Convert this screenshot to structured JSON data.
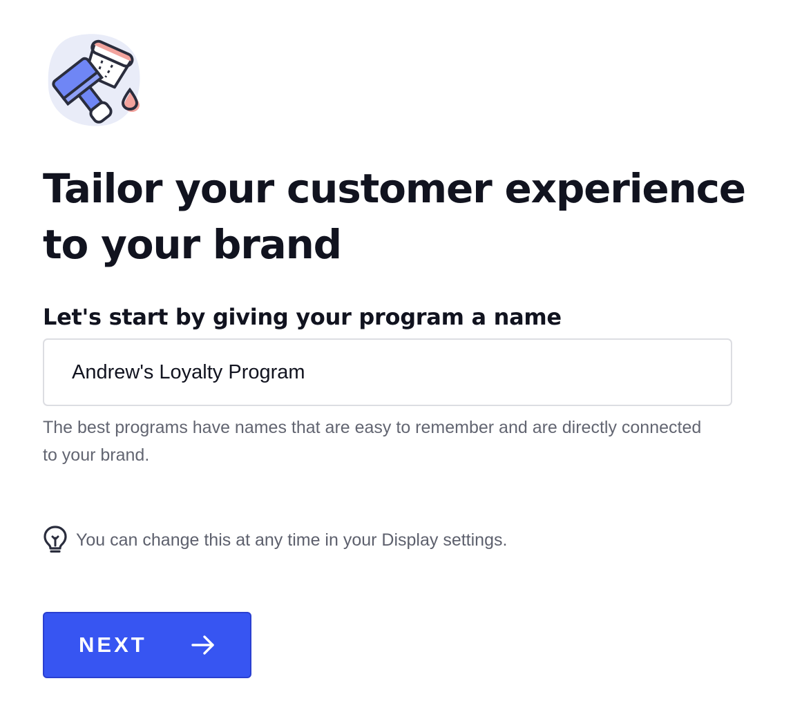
{
  "hero": {
    "icon": "paint-bucket-brush-icon",
    "headline": "Tailor your customer experience to your brand"
  },
  "form": {
    "name_label": "Let's start by giving your program a name",
    "name_value": "Andrew's Loyalty Program",
    "helper": "The best programs have names that are easy to remember and are directly connected to your brand."
  },
  "tip": {
    "icon": "lightbulb-icon",
    "text": "You can change this at any time in your Display settings."
  },
  "actions": {
    "next_label": "NEXT",
    "next_icon": "arrow-right-icon"
  },
  "colors": {
    "primary": "#3755f2",
    "text": "#11131f",
    "muted": "#626571",
    "accent_pink": "#f2a39d",
    "accent_blue": "#6f86f5",
    "blob": "#e9ecf8"
  }
}
